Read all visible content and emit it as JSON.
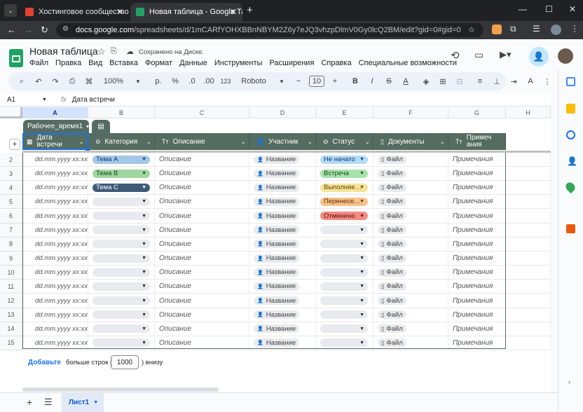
{
  "browser": {
    "tabs": [
      {
        "title": "Хостинговое сообщество «Tim",
        "favicon_color": "#e34234",
        "active": false
      },
      {
        "title": "Новая таблица - Google Табли",
        "favicon_color": "#1ea362",
        "active": true
      }
    ],
    "new_tab": "+",
    "url_host": "docs.google.com",
    "url_path": "/spreadsheets/d/1mCARfYOHXBBnNBYM2Z6y7eJQ3vhzpDlmV0Gy0lcQ2BM/edit?gid=0#gid=0"
  },
  "doc": {
    "title": "Новая таблица",
    "saved": "Сохранено на Диске.",
    "menu": [
      "Файл",
      "Правка",
      "Вид",
      "Вставка",
      "Формат",
      "Данные",
      "Инструменты",
      "Расширения",
      "Справка",
      "Специальные возможности"
    ]
  },
  "toolbar": {
    "zoom": "100%",
    "currency": "р.",
    "percent": "%",
    "dec_dec": ".0",
    "dec_inc": ".00",
    "format_123": "123",
    "font": "Roboto",
    "font_size": "10"
  },
  "formula": {
    "cell_ref": "A1",
    "fx": "fx",
    "value": "Дата встречи"
  },
  "grid": {
    "columns": [
      "A",
      "B",
      "C",
      "D",
      "E",
      "F",
      "G",
      "H"
    ],
    "rows": [
      "2",
      "3",
      "4",
      "5",
      "6",
      "7",
      "8",
      "9",
      "10",
      "11",
      "12",
      "13",
      "14",
      "15"
    ],
    "table_name": "Рабочее_время1",
    "headers": [
      "Дата встречи",
      "Категория",
      "Описание",
      "Участник",
      "Статус",
      "Документы",
      "Примечания"
    ],
    "placeholders": {
      "date": "dd.mm.yyyy xx:xx",
      "desc": "Описание",
      "person": "Название",
      "file": "Файл",
      "note": "Примечания"
    },
    "categories": [
      {
        "label": "Тема A",
        "bg": "#a7c7e7",
        "fg": "#0b3a6e"
      },
      {
        "label": "Тема B",
        "bg": "#9fd69f",
        "fg": "#124d12"
      },
      {
        "label": "Тема C",
        "bg": "#3f5b7a",
        "fg": "#ffffff"
      }
    ],
    "statuses": [
      {
        "label": "Не начато",
        "bg": "#b3dcf5",
        "fg": "#0b3a6e"
      },
      {
        "label": "Встреча",
        "bg": "#a7e2ac",
        "fg": "#124d12"
      },
      {
        "label": "Выполняе…",
        "bg": "#f7e39a",
        "fg": "#5a4500"
      },
      {
        "label": "Перенесе…",
        "bg": "#f8c28a",
        "fg": "#5a2b00"
      },
      {
        "label": "Отменено",
        "bg": "#f28b82",
        "fg": "#5c0f0a"
      }
    ]
  },
  "footer": {
    "add": "Добавьте",
    "more": "больше строк (",
    "count": "1000",
    "below": ") внизу"
  },
  "sheet_tab": "Лист1"
}
